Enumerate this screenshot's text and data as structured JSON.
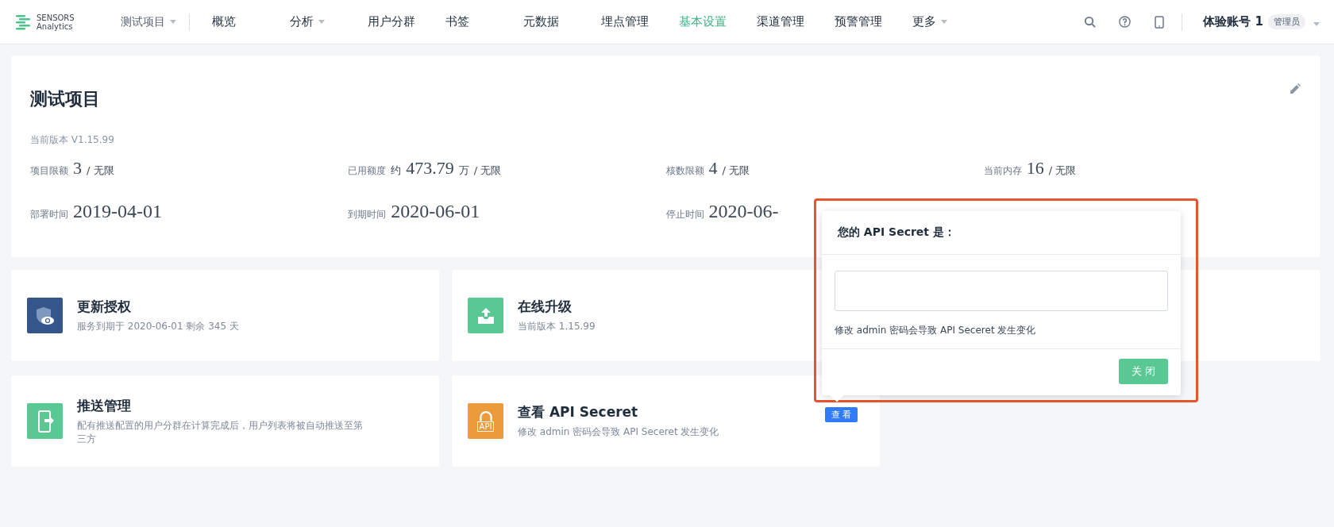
{
  "nav": {
    "logo": [
      "SENSORS",
      "Analytics"
    ],
    "project": "测试项目",
    "items": [
      {
        "label": "概览",
        "selected": false,
        "caret": false
      },
      {
        "label": "分析",
        "selected": false,
        "caret": true
      },
      {
        "label": "用户分群",
        "selected": false,
        "caret": false
      },
      {
        "label": "书签",
        "selected": false,
        "caret": false
      },
      {
        "label": "元数据",
        "selected": false,
        "caret": false
      },
      {
        "label": "埋点管理",
        "selected": false,
        "caret": false
      },
      {
        "label": "基本设置",
        "selected": true,
        "caret": false
      },
      {
        "label": "渠道管理",
        "selected": false,
        "caret": false
      },
      {
        "label": "预警管理",
        "selected": false,
        "caret": false
      },
      {
        "label": "更多",
        "selected": false,
        "caret": true
      }
    ],
    "account": "体验账号 1",
    "role": "管理员"
  },
  "project": {
    "title": "测试项目",
    "version": "当前版本 V1.15.99",
    "stats": [
      {
        "label": "项目限额",
        "value": "3",
        "suffix": "/ 无限"
      },
      {
        "label": "已用额度",
        "prefix": "约",
        "value": "473.79",
        "unit": "万",
        "suffix": "/ 无限"
      },
      {
        "label": "核数限额",
        "value": "4",
        "suffix": "/ 无限"
      },
      {
        "label": "当前内存",
        "value": "16",
        "suffix": "/ 无限"
      },
      {
        "label": "部署时间",
        "value": "2019-04-01"
      },
      {
        "label": "到期时间",
        "value": "2020-06-01"
      },
      {
        "label": "停止时间",
        "value": "2020-06-"
      }
    ]
  },
  "cards": [
    {
      "kind": "license",
      "color": "#34568b",
      "title": "更新授权",
      "subtitle": "服务到期于 2020-06-01 剩余 345 天"
    },
    {
      "kind": "upgrade",
      "color": "#5ac893",
      "title": "在线升级",
      "subtitle": "当前版本 1.15.99"
    },
    {
      "kind": "blank"
    },
    {
      "kind": "push",
      "color": "#5ac893",
      "title": "推送管理",
      "subtitle": "配有推送配置的用户分群在计算完成后，用户列表将被自动推送至第三方"
    },
    {
      "kind": "api",
      "color": "#eb9b3c",
      "icon_text": "API",
      "title": "查看 API Seceret",
      "subtitle": "修改 admin 密码会导致 API Seceret 发生变化",
      "action": "查 看"
    }
  ],
  "popover": {
    "title": "您的 API Secret 是：",
    "note": "修改 admin 密码会导致 API Seceret 发生变化",
    "close": "关 闭"
  }
}
